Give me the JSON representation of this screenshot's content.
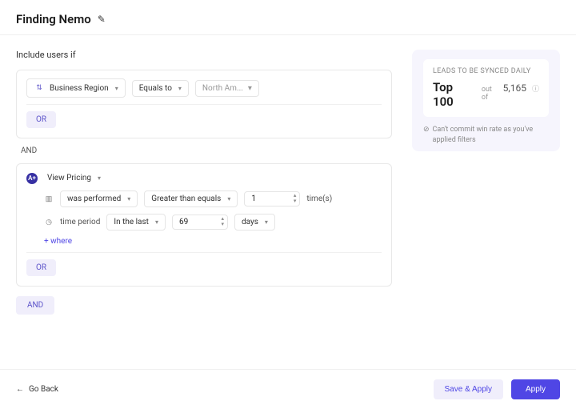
{
  "header": {
    "title": "Finding Nemo"
  },
  "section_label": "Include users if",
  "rule1": {
    "field": "Business Region",
    "operator": "Equals to",
    "value": "North Am..."
  },
  "or_label": "OR",
  "and_label": "AND",
  "rule2": {
    "event": "View Pricing",
    "performed": "was performed",
    "comparator": "Greater than equals",
    "count": "1",
    "times": "time(s)",
    "time_period_label": "time period",
    "range": "In the last",
    "num": "69",
    "unit": "days",
    "add_where": "+ where"
  },
  "panel": {
    "label": "LEADS TO BE SYNCED DAILY",
    "big": "Top 100",
    "out_of": "out of",
    "total": "5,165",
    "note": "Can't commit win rate as you've applied filters"
  },
  "footer": {
    "back": "Go Back",
    "save": "Save & Apply",
    "apply": "Apply"
  }
}
